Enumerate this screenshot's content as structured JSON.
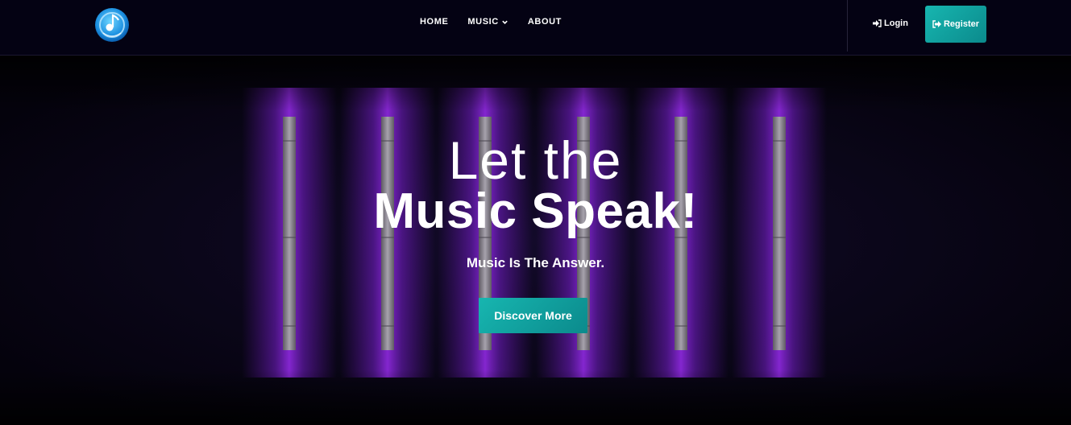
{
  "header": {
    "logo_icon": "music-disc-logo-icon",
    "nav": [
      {
        "label": "HOME"
      },
      {
        "label": "MUSIC",
        "icon": "chevron-down-icon"
      },
      {
        "label": "ABOUT"
      }
    ],
    "login_label": "Login",
    "login_icon": "sign-in-icon",
    "register_label": "Register",
    "register_icon": "sign-out-icon"
  },
  "hero": {
    "title_line1": "Let the",
    "title_line2": "Music Speak!",
    "subtitle": "Music Is The Answer.",
    "cta_label": "Discover More"
  },
  "colors": {
    "background": "#05030f",
    "accent": "#13a7a4",
    "neon": "#8a1fd6"
  }
}
